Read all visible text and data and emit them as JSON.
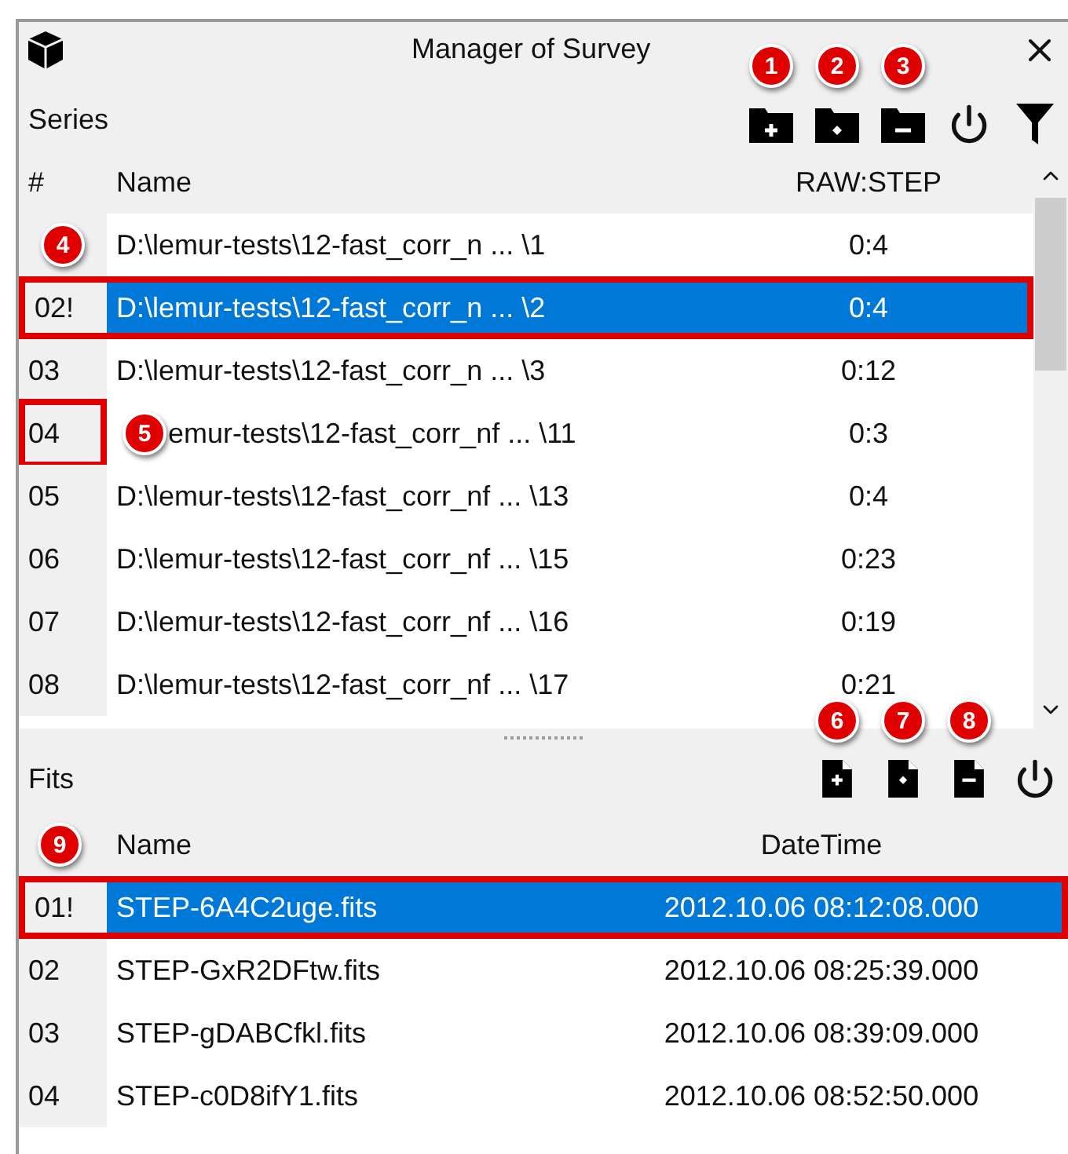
{
  "window": {
    "title": "Manager of Survey"
  },
  "series": {
    "label": "Series",
    "toolbar": [
      {
        "kind": "folder-plus",
        "callout": "1"
      },
      {
        "kind": "folder-diamond",
        "callout": "2"
      },
      {
        "kind": "folder-minus",
        "callout": "3"
      },
      {
        "kind": "power"
      },
      {
        "kind": "filter"
      }
    ],
    "columns": [
      "#",
      "Name",
      "RAW:STEP"
    ],
    "rows": [
      {
        "name": "D:\\lemur-tests\\12-fast_corr_n ... \\1",
        "raw_step": "0:4",
        "selected": false,
        "highlighted": false,
        "number_highlighted": false,
        "callout": "4"
      },
      {
        "number": "02!",
        "name": "D:\\lemur-tests\\12-fast_corr_n ... \\2",
        "raw_step": "0:4",
        "selected": true,
        "highlighted": true,
        "number_highlighted": false
      },
      {
        "number": "03",
        "name": "D:\\lemur-tests\\12-fast_corr_n ... \\3",
        "raw_step": "0:12",
        "selected": false,
        "highlighted": false,
        "number_highlighted": false
      },
      {
        "number": "04",
        "name": "emur-tests\\12-fast_corr_nf ... \\11",
        "raw_step": "0:3",
        "selected": false,
        "highlighted": false,
        "number_highlighted": true,
        "callout": "5"
      },
      {
        "number": "05",
        "name": "D:\\lemur-tests\\12-fast_corr_nf ... \\13",
        "raw_step": "0:4",
        "selected": false,
        "highlighted": false,
        "number_highlighted": false
      },
      {
        "number": "06",
        "name": "D:\\lemur-tests\\12-fast_corr_nf ... \\15",
        "raw_step": "0:23",
        "selected": false,
        "highlighted": false,
        "number_highlighted": false
      },
      {
        "number": "07",
        "name": "D:\\lemur-tests\\12-fast_corr_nf ... \\16",
        "raw_step": "0:19",
        "selected": false,
        "highlighted": false,
        "number_highlighted": false
      },
      {
        "number": "08",
        "name": "D:\\lemur-tests\\12-fast_corr_nf ... \\17",
        "raw_step": "0:21",
        "selected": false,
        "highlighted": false,
        "number_highlighted": false
      }
    ]
  },
  "fits": {
    "label": "Fits",
    "toolbar": [
      {
        "kind": "file-plus",
        "callout": "6"
      },
      {
        "kind": "file-diamond",
        "callout": "7"
      },
      {
        "kind": "file-minus",
        "callout": "8"
      },
      {
        "kind": "power"
      }
    ],
    "header_callout": "9",
    "columns": [
      "Name",
      "DateTime"
    ],
    "rows": [
      {
        "number": "01!",
        "name": "STEP-6A4C2uge.fits",
        "datetime": "2012.10.06 08:12:08.000",
        "selected": true,
        "highlighted": true
      },
      {
        "number": "02",
        "name": "STEP-GxR2DFtw.fits",
        "datetime": "2012.10.06 08:25:39.000",
        "selected": false,
        "highlighted": false
      },
      {
        "number": "03",
        "name": "STEP-gDABCfkl.fits",
        "datetime": "2012.10.06 08:39:09.000",
        "selected": false,
        "highlighted": false
      },
      {
        "number": "04",
        "name": "STEP-c0D8ifY1.fits",
        "datetime": "2012.10.06 08:52:50.000",
        "selected": false,
        "highlighted": false
      }
    ]
  }
}
